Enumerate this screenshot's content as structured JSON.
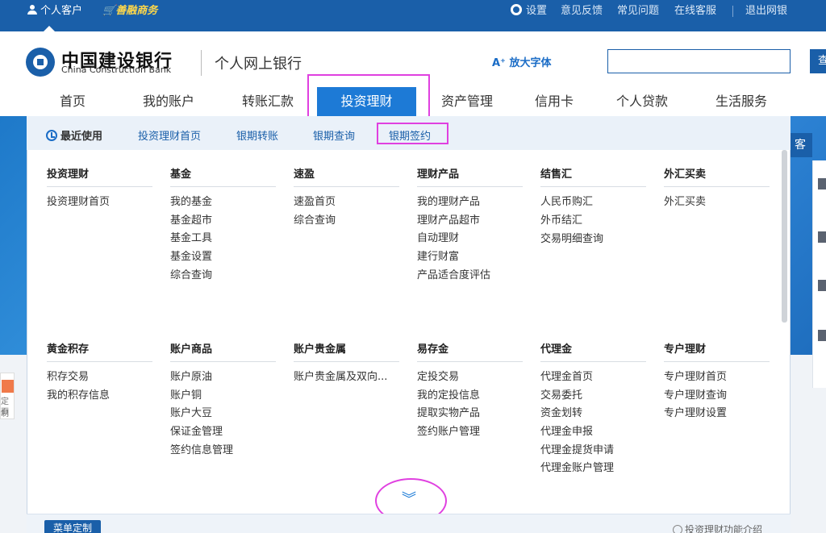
{
  "topbar": {
    "personal_customer": "个人客户",
    "shanrong": "善融商务",
    "settings": "设置",
    "feedback": "意见反馈",
    "faq": "常见问题",
    "online_service": "在线客服",
    "logout": "退出网银"
  },
  "header": {
    "bank_name_cn": "中国建设银行",
    "bank_name_en": "China Construction Bank",
    "site_name": "个人网上银行",
    "enlarge_font": "放大字体",
    "search_placeholder": "",
    "search_button": "查"
  },
  "nav": {
    "items": [
      {
        "label": "首页"
      },
      {
        "label": "我的账户"
      },
      {
        "label": "转账汇款"
      },
      {
        "label": "投资理财",
        "active": true
      },
      {
        "label": "资产管理"
      },
      {
        "label": "信用卡"
      },
      {
        "label": "个人贷款"
      },
      {
        "label": "生活服务"
      }
    ]
  },
  "recent": {
    "label": "最近使用",
    "links": [
      "投资理财首页",
      "银期转账",
      "银期查询",
      "银期签约"
    ]
  },
  "menu": {
    "row1": [
      {
        "title": "投资理财",
        "links": [
          "投资理财首页"
        ]
      },
      {
        "title": "基金",
        "links": [
          "我的基金",
          "基金超市",
          "基金工具",
          "基金设置",
          "综合查询"
        ]
      },
      {
        "title": "速盈",
        "links": [
          "速盈首页",
          "综合查询"
        ]
      },
      {
        "title": "理财产品",
        "links": [
          "我的理财产品",
          "理财产品超市",
          "自动理财",
          "建行财富",
          "产品适合度评估"
        ]
      },
      {
        "title": "结售汇",
        "links": [
          "人民币购汇",
          "外币结汇",
          "交易明细查询"
        ]
      },
      {
        "title": "外汇买卖",
        "links": [
          "外汇买卖"
        ]
      }
    ],
    "row2": [
      {
        "title": "黄金积存",
        "links": [
          "积存交易",
          "我的积存信息"
        ]
      },
      {
        "title": "账户商品",
        "links": [
          "账户原油",
          "账户铜",
          "账户大豆",
          "保证金管理",
          "签约信息管理"
        ]
      },
      {
        "title": "账户贵金属",
        "links": [
          "账户贵金属及双向..."
        ]
      },
      {
        "title": "易存金",
        "links": [
          "定投交易",
          "我的定投信息",
          "提取实物产品",
          "签约账户管理"
        ]
      },
      {
        "title": "代理金",
        "links": [
          "代理金首页",
          "交易委托",
          "资金划转",
          "代理金申报",
          "代理金提货申请",
          "代理金账户管理"
        ]
      },
      {
        "title": "专户理财",
        "links": [
          "专户理财首页",
          "专户理财查询",
          "专户理财设置"
        ]
      }
    ]
  },
  "footer": {
    "customize": "菜单定制",
    "intro": "投资理财功能介绍"
  },
  "banner": {
    "right_button": "客"
  },
  "left_fragment": {
    "line1": "定制",
    "line2": "页"
  },
  "colors": {
    "brand_blue": "#1a5fa9",
    "active_tab": "#1d7ad6",
    "highlight_magenta": "#e040e0"
  }
}
